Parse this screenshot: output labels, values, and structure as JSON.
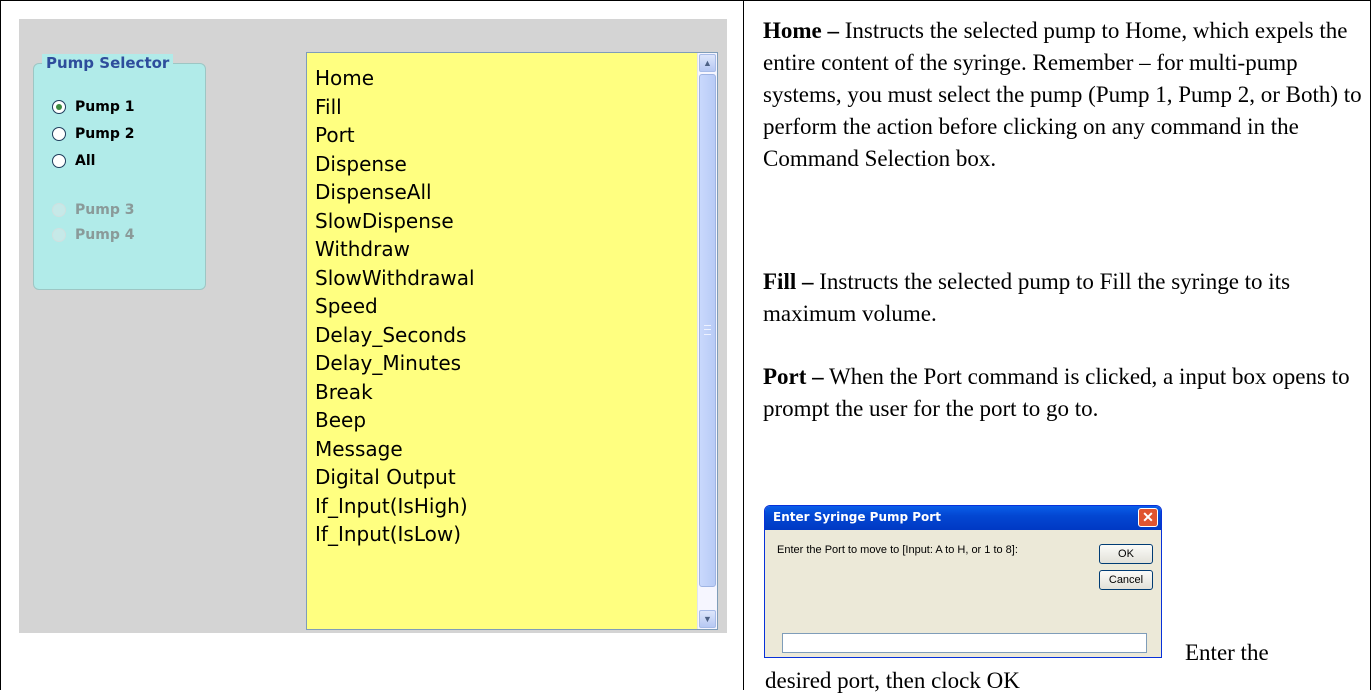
{
  "pump_selector": {
    "title": "Pump Selector",
    "options": [
      {
        "label": "Pump 1",
        "selected": true,
        "enabled": true
      },
      {
        "label": "Pump 2",
        "selected": false,
        "enabled": true
      },
      {
        "label": "All",
        "selected": false,
        "enabled": true
      },
      {
        "label": "Pump 3",
        "selected": false,
        "enabled": false
      },
      {
        "label": "Pump 4",
        "selected": false,
        "enabled": false
      }
    ]
  },
  "command_list": {
    "items": [
      "Home",
      "Fill",
      "Port",
      "Dispense",
      "DispenseAll",
      "SlowDispense",
      "Withdraw",
      "SlowWithdrawal",
      "Speed",
      "Delay_Seconds",
      "Delay_Minutes",
      "Break",
      "Beep",
      "Message",
      "Digital Output",
      "If_Input(IsHigh)",
      "If_Input(IsLow)"
    ]
  },
  "doc": {
    "home_term": "Home –",
    "home_text": " Instructs the selected pump to Home, which expels the entire content of the syringe. Remember – for multi-pump systems, you must select the pump (Pump 1, Pump 2, or Both) to perform the action before clicking on any command in the Command Selection box.",
    "fill_term": "Fill –",
    "fill_text": " Instructs the selected pump to Fill the syringe to its maximum volume.",
    "port_term": "Port –",
    "port_text": " When the Port command is clicked, a input box opens to prompt the user for the port to go to.",
    "after_dialog_1": "Enter the",
    "after_dialog_2": "desired port, then clock OK"
  },
  "dialog": {
    "title": "Enter Syringe Pump Port",
    "prompt": "Enter the Port to move to [Input: A to H, or 1 to 8]:",
    "ok_label": "OK",
    "cancel_label": "Cancel",
    "close_glyph": "✕",
    "input_value": ""
  },
  "colors": {
    "list_bg": "#ffff80",
    "selector_bg": "#b1ebe9",
    "selector_title": "#2e4d9c",
    "xp_titlebar": "#0347d2"
  }
}
